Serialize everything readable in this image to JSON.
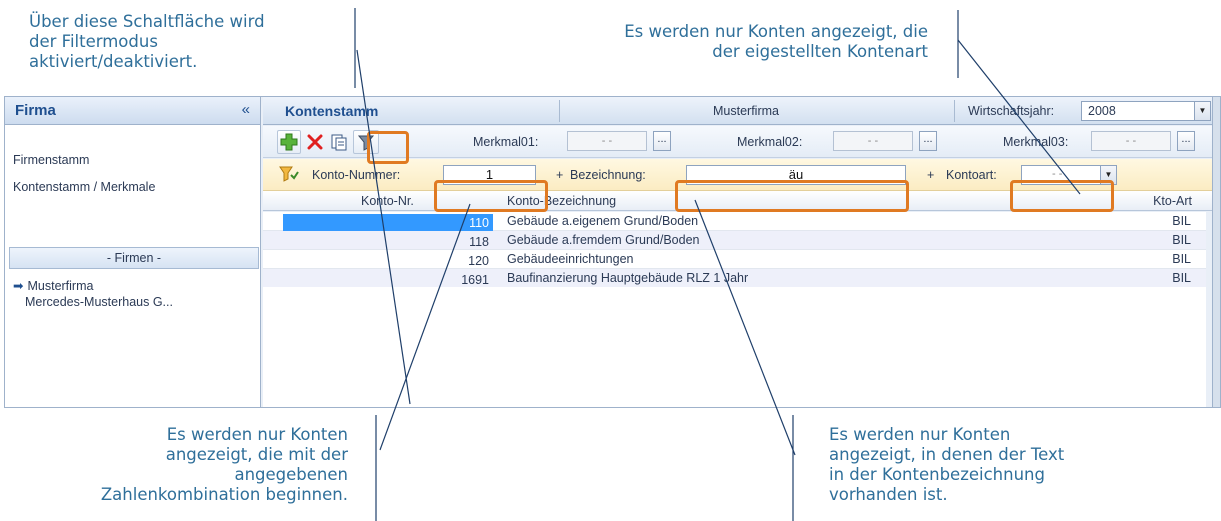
{
  "callouts": {
    "top_left": [
      "Über diese Schaltfläche wird",
      "der Filtermodus",
      "aktiviert/deaktiviert."
    ],
    "top_right": [
      "Es werden nur Konten angezeigt, die",
      "der eigestellten Kontenart"
    ],
    "bottom_left": [
      "Es werden nur Konten",
      "angezeigt, die mit der",
      "angegebenen",
      "Zahlenkombination beginnen."
    ],
    "bottom_right": [
      "Es werden nur Konten",
      "angezeigt, in denen der Text",
      "in der Kontenbezeichnung",
      "vorhanden ist."
    ]
  },
  "sidebar": {
    "title": "Firma",
    "collapse": "«",
    "links": [
      "Firmenstamm",
      "Kontenstamm / Merkmale"
    ],
    "section": "- Firmen -",
    "active_marker": "➡",
    "companies": [
      "Musterfirma",
      "Mercedes-Musterhaus G..."
    ]
  },
  "header": {
    "title": "Kontenstamm",
    "company": "Musterfirma",
    "year_label": "Wirtschaftsjahr:",
    "year_value": "2008",
    "combo_arrow": "▼"
  },
  "toolbar": {
    "merkmal01_label": "Merkmal01:",
    "merkmal01_value": "- -",
    "merkmal02_label": "Merkmal02:",
    "merkmal02_value": "- -",
    "merkmal03_label": "Merkmal03:",
    "merkmal03_value": "- -",
    "ellipsis": "..."
  },
  "filter": {
    "konto_label": "Konto-Nummer:",
    "konto_value": "1",
    "plus": "+",
    "bez_label": "Bezeichnung:",
    "bez_value": "äu",
    "art_label": "Kontoart:",
    "art_value": "- -"
  },
  "grid": {
    "columns": [
      "Konto-Nr.",
      "Konto-Bezeichnung",
      "Kto-Art"
    ],
    "rows": [
      {
        "nr": "110",
        "bez": "Gebäude a.eigenem Grund/Boden",
        "art": "BIL"
      },
      {
        "nr": "118",
        "bez": "Gebäude a.fremdem Grund/Boden",
        "art": "BIL"
      },
      {
        "nr": "120",
        "bez": "Gebäudeeinrichtungen",
        "art": "BIL"
      },
      {
        "nr": "1691",
        "bez": "Baufinanzierung Hauptgebäude RLZ 1 Jahr",
        "art": "BIL"
      }
    ]
  },
  "colors": {
    "accent": "#1f4f8f",
    "callout_text": "#2f6f9a",
    "highlight": "#e07a22",
    "selected_cell": "#3399ff"
  }
}
